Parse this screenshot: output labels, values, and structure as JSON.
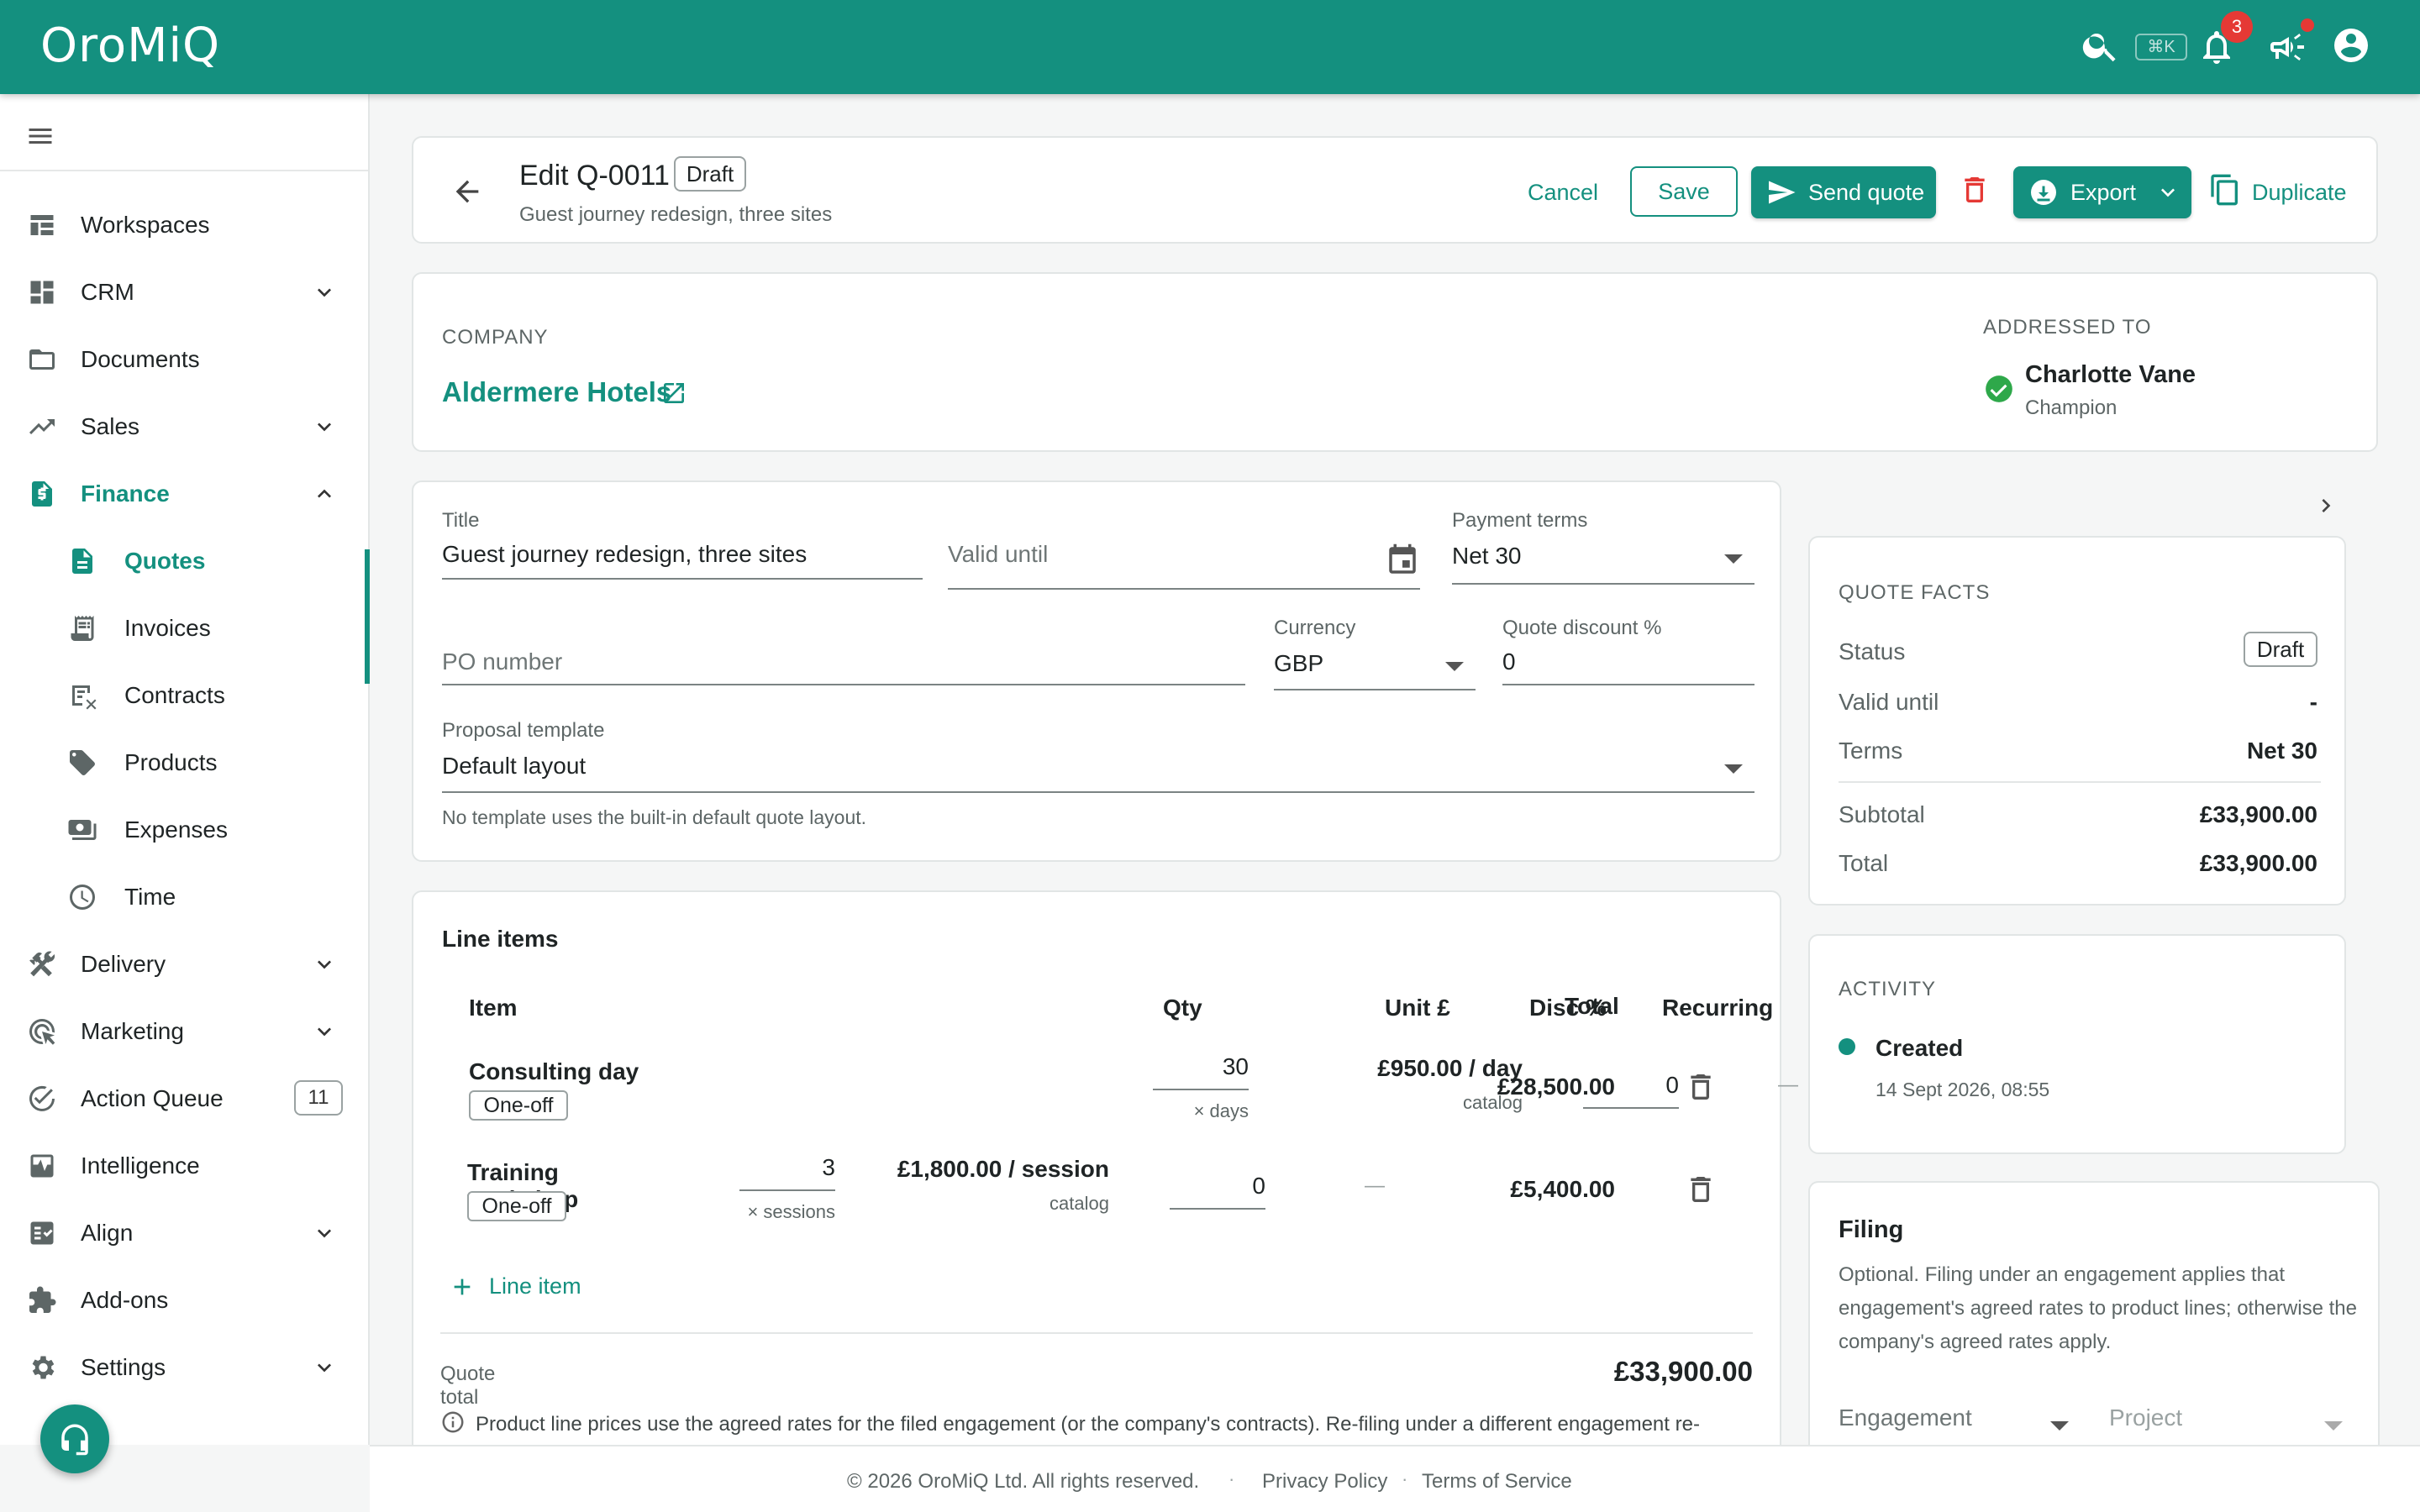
{
  "app": {
    "name": "OroMiQ",
    "shortcut": "⌘K",
    "notifications_count": "3"
  },
  "sidebar": {
    "items": [
      {
        "label": "Workspaces"
      },
      {
        "label": "CRM"
      },
      {
        "label": "Documents"
      },
      {
        "label": "Sales"
      },
      {
        "label": "Finance"
      },
      {
        "label": "Quotes"
      },
      {
        "label": "Invoices"
      },
      {
        "label": "Contracts"
      },
      {
        "label": "Products"
      },
      {
        "label": "Expenses"
      },
      {
        "label": "Time"
      },
      {
        "label": "Delivery"
      },
      {
        "label": "Marketing"
      },
      {
        "label": "Action Queue",
        "badge": "11"
      },
      {
        "label": "Intelligence"
      },
      {
        "label": "Align"
      },
      {
        "label": "Add-ons"
      },
      {
        "label": "Settings"
      }
    ]
  },
  "header": {
    "title": "Edit Q-0011",
    "status": "Draft",
    "subtitle": "Guest journey redesign, three sites",
    "cancel": "Cancel",
    "save": "Save",
    "send": "Send quote",
    "export": "Export",
    "duplicate": "Duplicate"
  },
  "company": {
    "label": "COMPANY",
    "name": "Aldermere Hotels",
    "addressed_label": "ADDRESSED TO",
    "contact_name": "Charlotte Vane",
    "contact_role": "Champion"
  },
  "form": {
    "title_label": "Title",
    "title_value": "Guest journey redesign, three sites",
    "valid_until_placeholder": "Valid until",
    "payment_terms_label": "Payment terms",
    "payment_terms_value": "Net 30",
    "po_placeholder": "PO number",
    "currency_label": "Currency",
    "currency_value": "GBP",
    "discount_label": "Quote discount %",
    "discount_value": "0",
    "template_label": "Proposal template",
    "template_value": "Default layout",
    "template_help": "No template uses the built-in default quote layout."
  },
  "line_items": {
    "title": "Line items",
    "columns": {
      "item": "Item",
      "qty": "Qty",
      "unit": "Unit £",
      "disc": "Disc %",
      "recurring": "Recurring",
      "total": "Total"
    },
    "rows": [
      {
        "name": "Consulting day",
        "tag": "One-off",
        "qty": "30",
        "qty_unit": "× days",
        "price": "£950.00 / day",
        "price_source": "catalog",
        "disc": "0",
        "recurring": "—",
        "total": "£28,500.00"
      },
      {
        "name": "Training workshop",
        "tag": "One-off",
        "qty": "3",
        "qty_unit": "× sessions",
        "price": "£1,800.00 / session",
        "price_source": "catalog",
        "disc": "0",
        "recurring": "—",
        "total": "£5,400.00"
      }
    ],
    "add_label": "Line item",
    "total_label": "Quote total",
    "total_value": "£33,900.00",
    "info": "Product line prices use the agreed rates for the filed engagement (or the company's contracts). Re-filing under a different engagement re-"
  },
  "facts": {
    "title": "QUOTE FACTS",
    "status_label": "Status",
    "status_value": "Draft",
    "valid_label": "Valid until",
    "valid_value": "-",
    "terms_label": "Terms",
    "terms_value": "Net 30",
    "subtotal_label": "Subtotal",
    "subtotal_value": "£33,900.00",
    "total_label": "Total",
    "total_value": "£33,900.00"
  },
  "activity": {
    "title": "ACTIVITY",
    "event": "Created",
    "time": "14 Sept 2026, 08:55"
  },
  "filing": {
    "title": "Filing",
    "description": "Optional. Filing under an engagement applies that engagement's agreed rates to product lines; otherwise the company's agreed rates apply.",
    "engagement_placeholder": "Engagement",
    "project_placeholder": "Project"
  },
  "footer": {
    "copyright": "© 2026 OroMiQ Ltd. All rights reserved.",
    "privacy": "Privacy Policy",
    "terms": "Terms of Service"
  },
  "colors": {
    "accent": "#14907f",
    "danger": "#e53935"
  }
}
